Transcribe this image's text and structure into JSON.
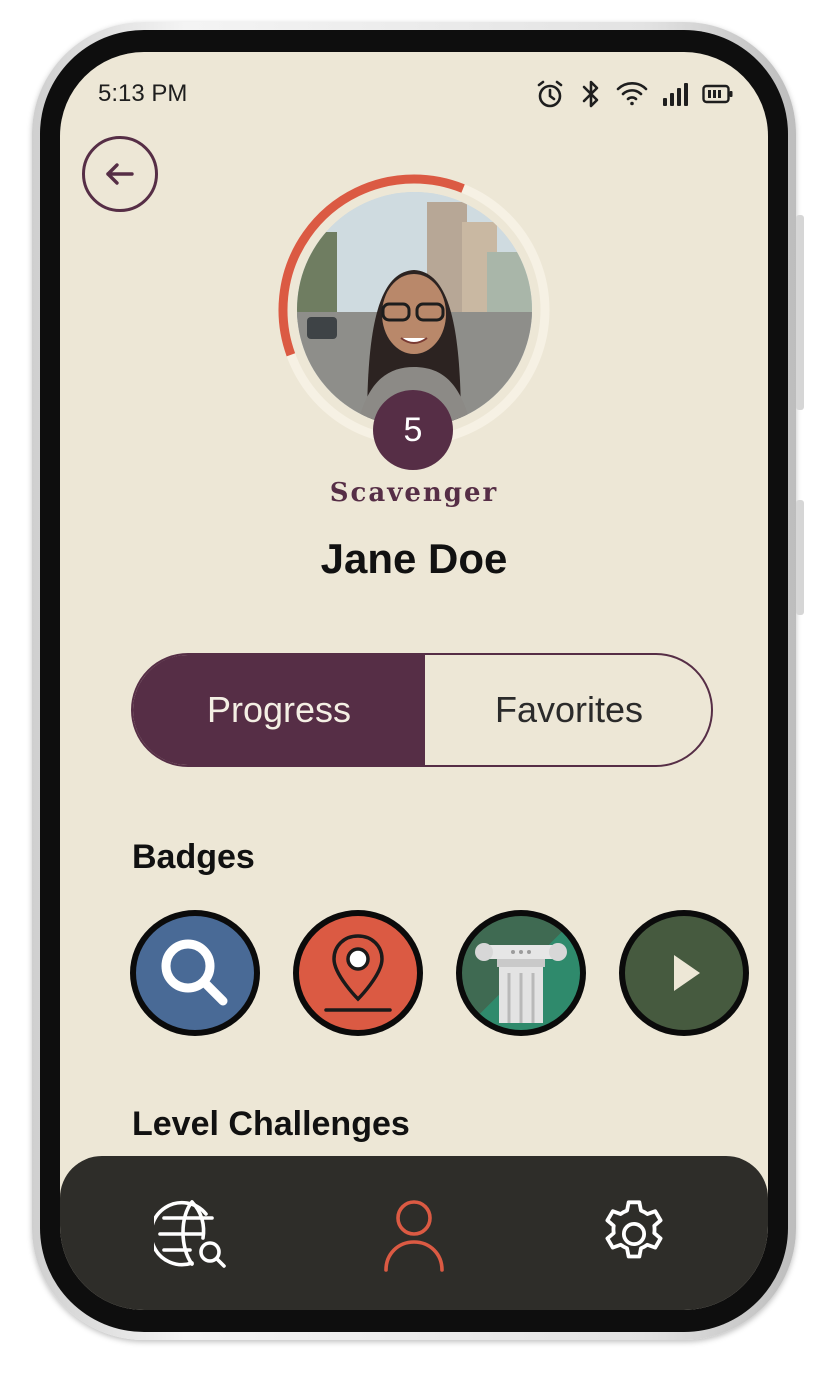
{
  "status_bar": {
    "time": "5:13 PM",
    "icons": [
      "alarm-icon",
      "bluetooth-icon",
      "wifi-icon",
      "signal-icon",
      "battery-icon"
    ]
  },
  "header": {
    "back_icon": "arrow-left-icon"
  },
  "profile": {
    "level": "5",
    "rank": "Scavenger",
    "name": "Jane Doe",
    "level_progress": 0.3
  },
  "tabs": [
    {
      "label": "Progress",
      "active": true
    },
    {
      "label": "Favorites",
      "active": false
    }
  ],
  "badges": {
    "title": "Badges",
    "items": [
      {
        "icon": "search-icon",
        "color": "#496a96"
      },
      {
        "icon": "location-pin-icon",
        "color": "#db5a43"
      },
      {
        "icon": "column-icon",
        "color": "#3f6a52"
      },
      {
        "icon": "play-icon",
        "color": "#465a3f"
      }
    ]
  },
  "challenges": {
    "title": "Level Challenges"
  },
  "bottom_nav": {
    "items": [
      {
        "icon": "globe-search-icon",
        "active": false
      },
      {
        "icon": "user-icon",
        "active": true
      },
      {
        "icon": "gear-icon",
        "active": false
      }
    ]
  },
  "colors": {
    "primary": "#562e46",
    "accent": "#db5a43",
    "background": "#ede7d6",
    "nav_background": "#2e2d29"
  }
}
